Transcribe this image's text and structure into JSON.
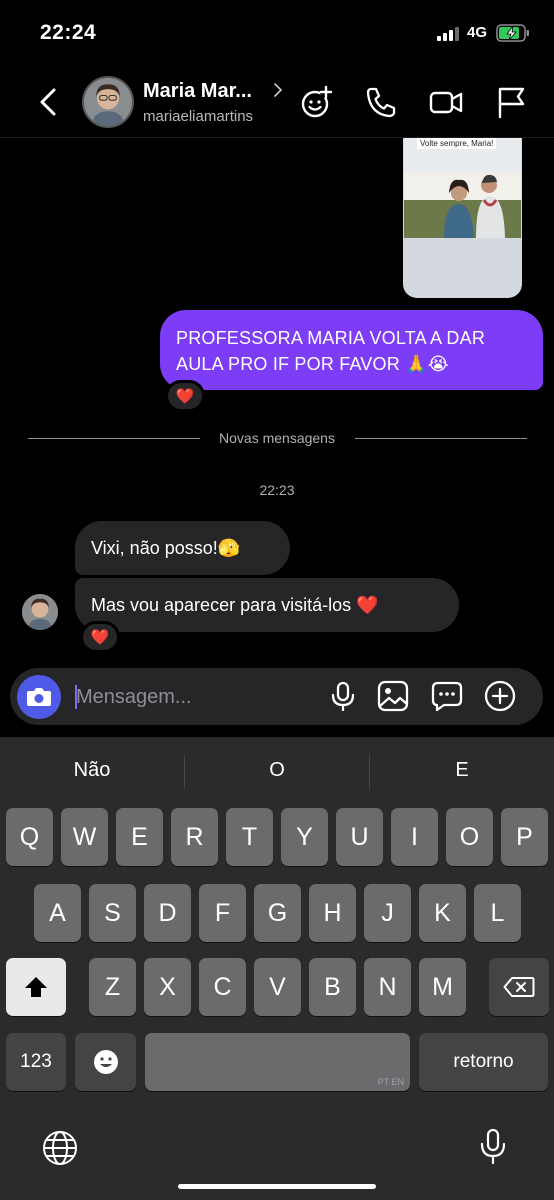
{
  "status_bar": {
    "time": "22:24",
    "network": "4G"
  },
  "header": {
    "name": "Maria Mar...",
    "username": "mariaeliamartins",
    "icons": [
      "back-chevron-icon",
      "effects-icon",
      "phone-icon",
      "video-icon",
      "flag-icon"
    ]
  },
  "media": {
    "caption": "Volte sempre, Maria!"
  },
  "messages": {
    "outgoing_1": {
      "text": "PROFESSORA MARIA VOLTA A DAR AULA PRO IF POR FAVOR 🙏😭",
      "reaction": "❤️"
    },
    "divider": "Novas mensagens",
    "timestamp": "22:23",
    "incoming_1": {
      "text": "Vixi, não posso!🫣"
    },
    "incoming_2": {
      "text": "Mas vou aparecer para visitá-los ❤️",
      "reaction": "❤️"
    }
  },
  "composer": {
    "placeholder": "Mensagem..."
  },
  "keyboard": {
    "suggestions": [
      "Não",
      "O",
      "E"
    ],
    "row1": [
      "Q",
      "W",
      "E",
      "R",
      "T",
      "Y",
      "U",
      "I",
      "O",
      "P"
    ],
    "row2": [
      "A",
      "S",
      "D",
      "F",
      "G",
      "H",
      "J",
      "K",
      "L"
    ],
    "row3": [
      "Z",
      "X",
      "C",
      "V",
      "B",
      "N",
      "M"
    ],
    "numbers_key": "123",
    "space_languages": "PT EN",
    "return_key": "retorno"
  },
  "colors": {
    "accent": "#7d3cf6",
    "camera": "#4f5be8",
    "battery": "#34c759",
    "heart": "#ff2d55"
  }
}
